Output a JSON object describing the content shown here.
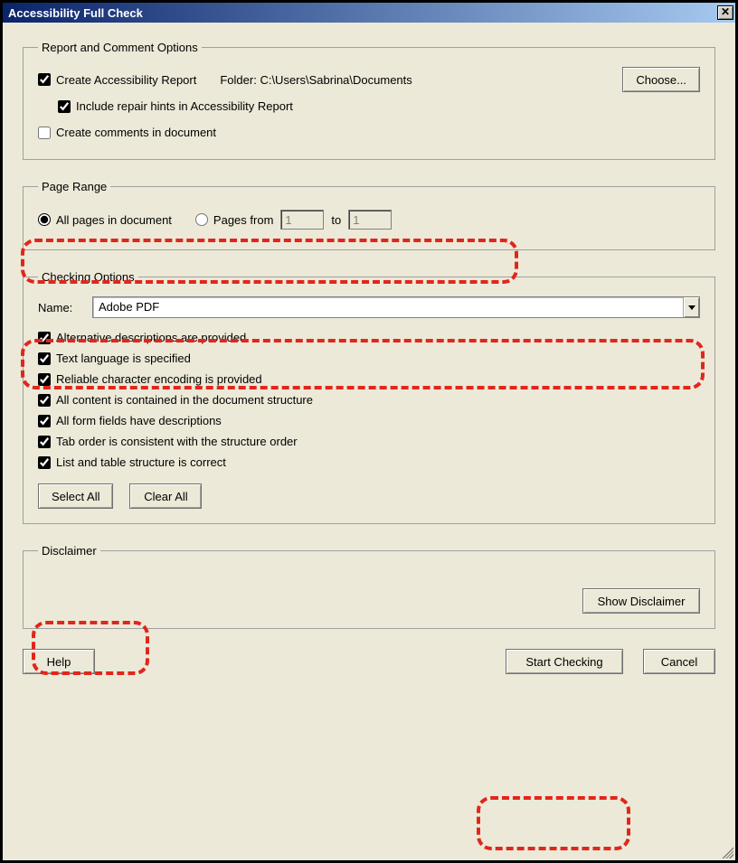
{
  "window": {
    "title": "Accessibility Full Check"
  },
  "report": {
    "legend": "Report and Comment Options",
    "create_report_label": "Create Accessibility Report",
    "folder_label": "Folder:",
    "folder_path": "C:\\Users\\Sabrina\\Documents",
    "choose_label": "Choose...",
    "include_hints_label": "Include repair hints in Accessibility Report",
    "create_comments_label": "Create comments in document"
  },
  "page_range": {
    "legend": "Page Range",
    "all_pages_label": "All pages in document",
    "pages_from_label": "Pages from",
    "to_label": "to",
    "from_value": "1",
    "to_value": "1"
  },
  "checking": {
    "legend": "Checking Options",
    "name_label": "Name:",
    "name_value": "Adobe PDF",
    "options": [
      "Alternative descriptions are provided",
      "Text language is specified",
      "Reliable character encoding is provided",
      "All content is contained in the document structure",
      "All form fields have descriptions",
      "Tab order is consistent with the structure order",
      "List and table structure is correct"
    ],
    "select_all_label": "Select All",
    "clear_all_label": "Clear All"
  },
  "disclaimer": {
    "legend": "Disclaimer",
    "show_label": "Show Disclaimer"
  },
  "buttons": {
    "help": "Help",
    "start": "Start Checking",
    "cancel": "Cancel"
  }
}
